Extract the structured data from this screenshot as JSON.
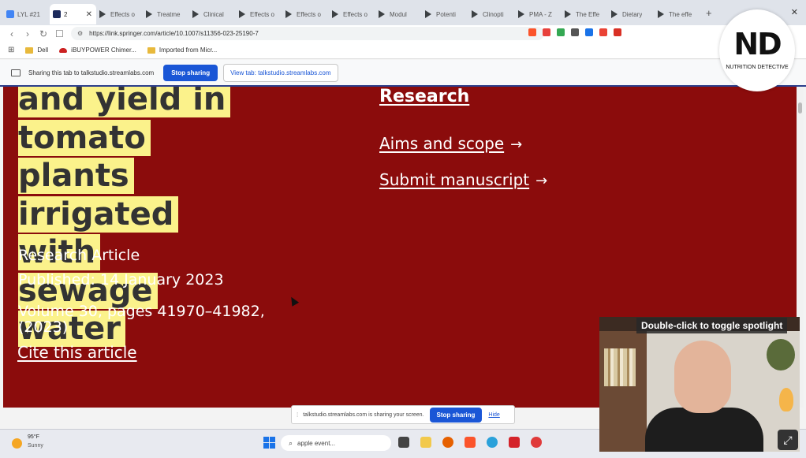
{
  "browser": {
    "tabs": [
      {
        "label": "LYL #21",
        "icon": "doc-icon",
        "active": false
      },
      {
        "label": "2",
        "icon": "springer-icon",
        "active": true
      },
      {
        "label": "Effects o",
        "icon": "play-icon",
        "active": false
      },
      {
        "label": "Treatme",
        "icon": "play-icon",
        "active": false
      },
      {
        "label": "Clinical",
        "icon": "play-icon",
        "active": false
      },
      {
        "label": "Effects o",
        "icon": "play-icon",
        "active": false
      },
      {
        "label": "Effects o",
        "icon": "play-icon",
        "active": false
      },
      {
        "label": "Effects o",
        "icon": "play-icon",
        "active": false
      },
      {
        "label": "Modul",
        "icon": "play-icon",
        "active": false
      },
      {
        "label": "Potenti",
        "icon": "play-icon",
        "active": false
      },
      {
        "label": "Clinopti",
        "icon": "play-icon",
        "active": false
      },
      {
        "label": "PMA - Z",
        "icon": "play-icon",
        "active": false
      },
      {
        "label": "The Effe",
        "icon": "play-icon",
        "active": false
      },
      {
        "label": "Dietary",
        "icon": "play-icon",
        "active": false
      },
      {
        "label": "The effe",
        "icon": "play-icon",
        "active": false
      }
    ],
    "new_tab": "+",
    "close_window": "✕",
    "url": "https://link.springer.com/article/10.1007/s11356-023-25190-7",
    "bookmarks": [
      {
        "label": "Dell",
        "icon": "folder-icon"
      },
      {
        "label": "iBUYPOWER Chimer...",
        "icon": "ibuypower-icon"
      },
      {
        "label": "Imported from Micr...",
        "icon": "folder-icon"
      }
    ]
  },
  "sharing_bar": {
    "message": "Sharing this tab to talkstudio.streamlabs.com",
    "stop_label": "Stop sharing",
    "view_label": "View tab: talkstudio.streamlabs.com"
  },
  "article": {
    "title_lines": [
      "and yield in",
      "tomato plants",
      "irrigated with",
      "sewage water"
    ],
    "type": "Research Article",
    "published": "Published: 14 January 2023",
    "volume": "Volume 30, pages 41970–41982, (2023)",
    "cite": "Cite this article"
  },
  "journal_links": {
    "research": "Research",
    "aims": "Aims and scope",
    "submit": "Submit manuscript",
    "arrow": "→"
  },
  "share_pill": {
    "message": "talkstudio.streamlabs.com is sharing your screen.",
    "stop_label": "Stop sharing",
    "hide_label": "Hide"
  },
  "taskbar": {
    "temperature": "95°F",
    "condition": "Sunny",
    "search_text": "apple event..."
  },
  "webcam": {
    "label": "Double-click to toggle spotlight"
  },
  "logo": {
    "mark": "ND",
    "text": "NUTRITION DETECTIVE"
  },
  "colors": {
    "page_background": "#8b0c0c",
    "highlight": "#fbf28b",
    "accent_blue": "#1a56d6"
  }
}
